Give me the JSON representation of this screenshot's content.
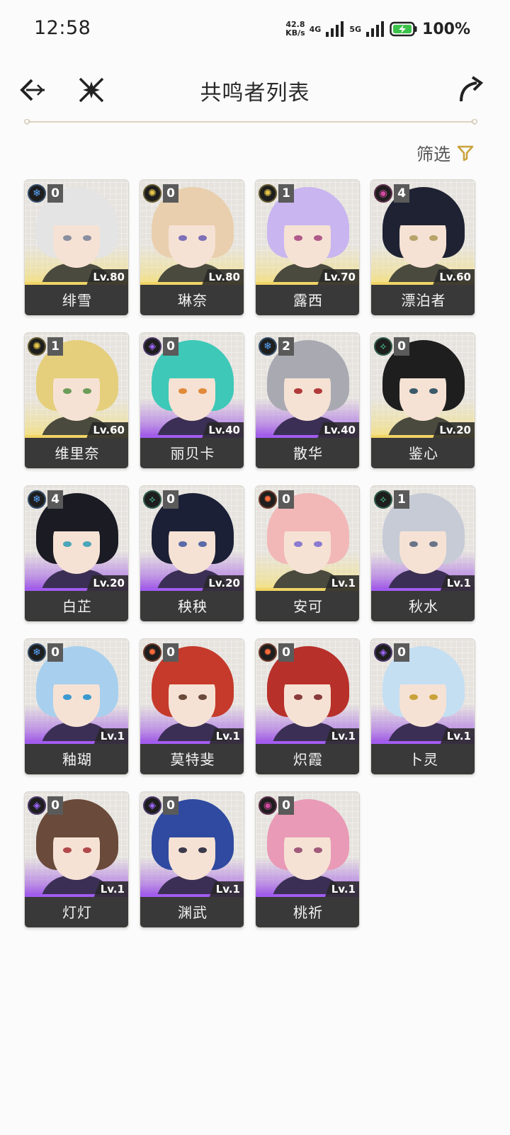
{
  "status_bar": {
    "time": "12:58",
    "net_speed_value": "42.8",
    "net_speed_unit": "KB/s",
    "net1": "4G",
    "net2": "5G",
    "battery": "100%"
  },
  "header": {
    "title": "共鸣者列表",
    "back_icon": "back-arrow-icon",
    "crossed_swords_icon": "crossed-swords-icon",
    "share_icon": "share-arrow-icon"
  },
  "filter_label": "筛选",
  "colors": {
    "gold_rarity": "#f0d466",
    "purple_rarity": "#a25cf0",
    "glacio": "#5aa8ff",
    "spectro": "#e8c84a",
    "havoc": "#d14aa0",
    "electro": "#a067ff",
    "aero": "#4fd6a0",
    "fusion": "#ff6a3a"
  },
  "resonators": [
    {
      "name": "绯雪",
      "level": "Lv.80",
      "sequence": "0",
      "element": "glacio",
      "rarity": "gold",
      "hair": "#e4e4e4",
      "eye": "#8a8fa0"
    },
    {
      "name": "琳奈",
      "level": "Lv.80",
      "sequence": "0",
      "element": "spectro",
      "rarity": "gold",
      "hair": "#e9cfae",
      "eye": "#7e6fb8"
    },
    {
      "name": "露西",
      "level": "Lv.70",
      "sequence": "1",
      "element": "spectro",
      "rarity": "gold",
      "hair": "#c9b5f0",
      "eye": "#b05a8a"
    },
    {
      "name": "漂泊者",
      "level": "Lv.60",
      "sequence": "4",
      "element": "havoc",
      "rarity": "gold",
      "hair": "#1f2233",
      "eye": "#b8a36a"
    },
    {
      "name": "维里奈",
      "level": "Lv.60",
      "sequence": "1",
      "element": "spectro",
      "rarity": "gold",
      "hair": "#e5cf7c",
      "eye": "#6d9c5a"
    },
    {
      "name": "丽贝卡",
      "level": "Lv.40",
      "sequence": "0",
      "element": "electro",
      "rarity": "purple",
      "hair": "#3ec8b8",
      "eye": "#e08a3a"
    },
    {
      "name": "散华",
      "level": "Lv.40",
      "sequence": "2",
      "element": "glacio",
      "rarity": "purple",
      "hair": "#a9a9b2",
      "eye": "#b03a3a"
    },
    {
      "name": "鉴心",
      "level": "Lv.20",
      "sequence": "0",
      "element": "aero",
      "rarity": "gold",
      "hair": "#1e1e1e",
      "eye": "#3a5a6a"
    },
    {
      "name": "白芷",
      "level": "Lv.20",
      "sequence": "4",
      "element": "glacio",
      "rarity": "purple",
      "hair": "#1b1b24",
      "eye": "#4aa6b8"
    },
    {
      "name": "秧秧",
      "level": "Lv.20",
      "sequence": "0",
      "element": "aero",
      "rarity": "purple",
      "hair": "#1c2036",
      "eye": "#5a6aa8"
    },
    {
      "name": "安可",
      "level": "Lv.1",
      "sequence": "0",
      "element": "fusion",
      "rarity": "gold",
      "hair": "#f2b8b8",
      "eye": "#8a7ad0"
    },
    {
      "name": "秋水",
      "level": "Lv.1",
      "sequence": "1",
      "element": "aero",
      "rarity": "purple",
      "hair": "#c7cbd6",
      "eye": "#6a7488"
    },
    {
      "name": "釉瑚",
      "level": "Lv.1",
      "sequence": "0",
      "element": "glacio",
      "rarity": "purple",
      "hair": "#a8cfee",
      "eye": "#3a9ad0"
    },
    {
      "name": "莫特斐",
      "level": "Lv.1",
      "sequence": "0",
      "element": "fusion",
      "rarity": "purple",
      "hair": "#c53a2a",
      "eye": "#6a4a3a"
    },
    {
      "name": "炽霞",
      "level": "Lv.1",
      "sequence": "0",
      "element": "fusion",
      "rarity": "purple",
      "hair": "#b8302a",
      "eye": "#8a3a3a"
    },
    {
      "name": "卜灵",
      "level": "Lv.1",
      "sequence": "0",
      "element": "electro",
      "rarity": "purple",
      "hair": "#c4def2",
      "eye": "#c9a23a"
    },
    {
      "name": "灯灯",
      "level": "Lv.1",
      "sequence": "0",
      "element": "electro",
      "rarity": "purple",
      "hair": "#6a4a3a",
      "eye": "#b04a4a"
    },
    {
      "name": "渊武",
      "level": "Lv.1",
      "sequence": "0",
      "element": "electro",
      "rarity": "purple",
      "hair": "#2f4aa0",
      "eye": "#3a3a4a"
    },
    {
      "name": "桃祈",
      "level": "Lv.1",
      "sequence": "0",
      "element": "havoc",
      "rarity": "purple",
      "hair": "#e99ab6",
      "eye": "#a05a7a"
    }
  ]
}
